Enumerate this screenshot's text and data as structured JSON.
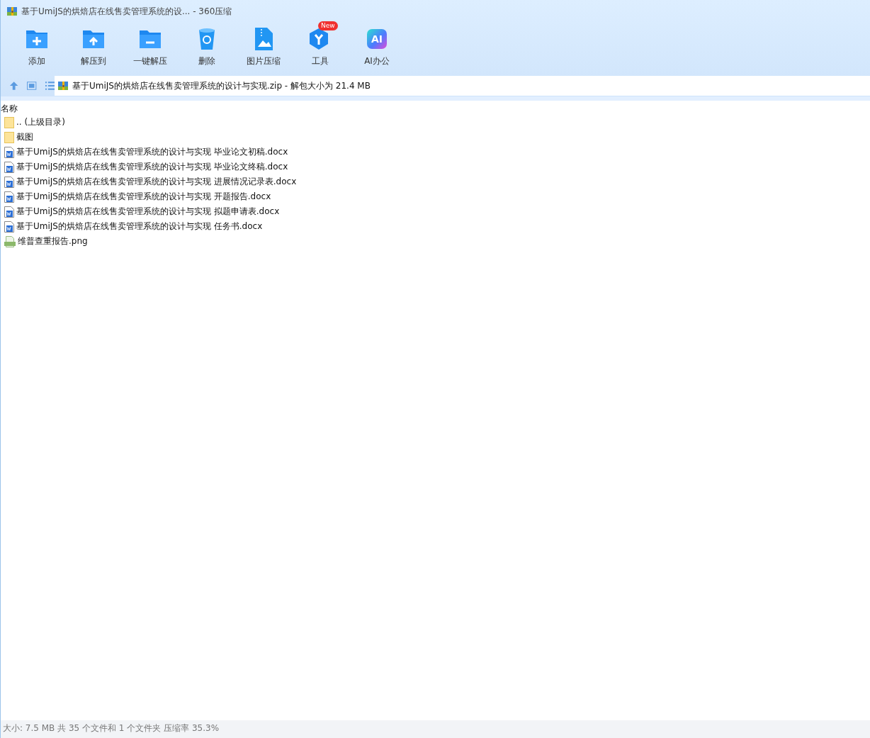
{
  "window": {
    "title": "基于UmiJS的烘焙店在线售卖管理系统的设... - 360压缩"
  },
  "toolbar": [
    {
      "kind": "add",
      "label": "添加"
    },
    {
      "kind": "extract",
      "label": "解压到"
    },
    {
      "kind": "oneclick",
      "label": "一键解压"
    },
    {
      "kind": "delete",
      "label": "删除"
    },
    {
      "kind": "image",
      "label": "图片压缩"
    },
    {
      "kind": "tools",
      "label": "工具",
      "badge": "New"
    },
    {
      "kind": "ai",
      "label": "AI办公",
      "glyph": "AI"
    }
  ],
  "address_bar": {
    "path": "基于UmiJS的烘焙店在线售卖管理系统的设计与实现.zip - 解包大小为 21.4 MB"
  },
  "file_list": {
    "columns": [
      "名称"
    ],
    "rows": [
      {
        "kind": "folder",
        "name": ".. (上级目录)"
      },
      {
        "kind": "folder",
        "name": "截图"
      },
      {
        "kind": "docx",
        "name": "基于UmiJS的烘焙店在线售卖管理系统的设计与实现 毕业论文初稿.docx"
      },
      {
        "kind": "docx",
        "name": "基于UmiJS的烘焙店在线售卖管理系统的设计与实现 毕业论文终稿.docx"
      },
      {
        "kind": "docx",
        "name": "基于UmiJS的烘焙店在线售卖管理系统的设计与实现 进展情况记录表.docx"
      },
      {
        "kind": "docx",
        "name": "基于UmiJS的烘焙店在线售卖管理系统的设计与实现 开题报告.docx"
      },
      {
        "kind": "docx",
        "name": "基于UmiJS的烘焙店在线售卖管理系统的设计与实现 拟题申请表.docx"
      },
      {
        "kind": "docx",
        "name": "基于UmiJS的烘焙店在线售卖管理系统的设计与实现 任务书.docx"
      },
      {
        "kind": "png",
        "name": "维普查重报告.png"
      }
    ]
  },
  "status_bar": "大小: 7.5 MB 共 35 个文件和 1 个文件夹 压缩率 35.3%"
}
